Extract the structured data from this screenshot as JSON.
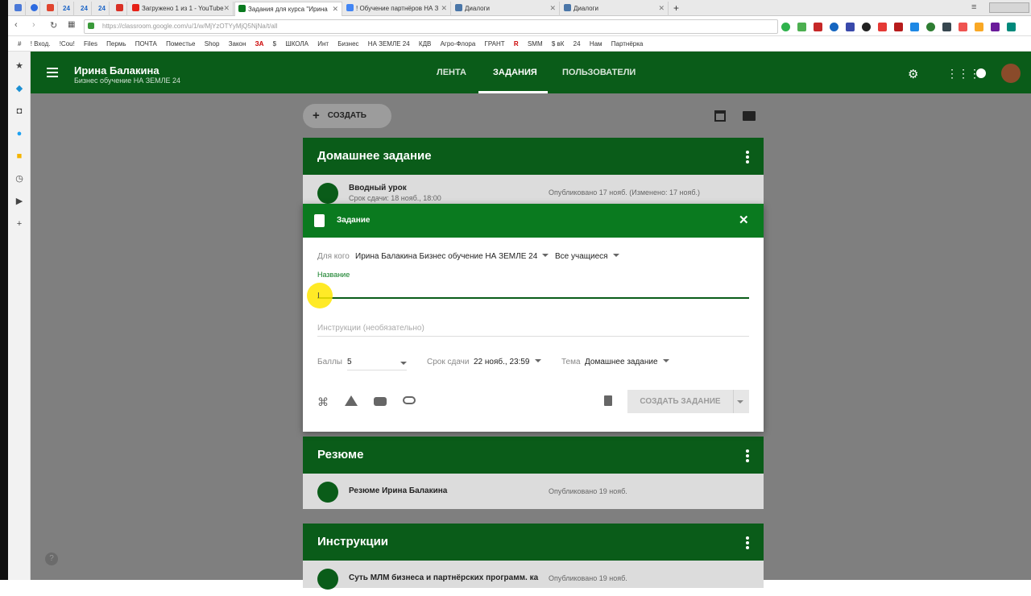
{
  "browser": {
    "tabs": [
      {
        "label": "24",
        "icon": "app-24"
      },
      {
        "label": "24",
        "icon": "app-24"
      },
      {
        "label": "24",
        "icon": "app-24"
      },
      {
        "label": "Загружено 1 из 1 - YouTube",
        "icon": "youtube-icon"
      },
      {
        "label": "Задания для курса \"Ирина",
        "icon": "classroom-icon",
        "active": true
      },
      {
        "label": "! Обучение партнёров НА З",
        "icon": "doc-icon"
      },
      {
        "label": "Диалоги",
        "icon": "chat-icon"
      },
      {
        "label": "Диалоги",
        "icon": "chat-icon"
      }
    ],
    "url": "https://classroom.google.com/u/1/w/MjYzOTYyMjQ5NjNa/t/all",
    "bookmarks": [
      "#",
      "! Вход.",
      "!Cou!",
      "Files",
      "Пермь",
      "ПОЧТА",
      "Поместье",
      "Shop",
      "Закон",
      "ЗА",
      "$",
      "ШКОЛА",
      "Инт",
      "Бизнес",
      "НА ЗЕМЛЕ 24",
      "КДВ",
      "Агро-Флора",
      "ГРАНТ",
      "R",
      "SMM",
      "$ вК",
      "24",
      "Нам",
      "Партнёрка"
    ]
  },
  "header": {
    "title": "Ирина Балакина",
    "subtitle": "Бизнес обучение НА ЗЕМЛЕ 24",
    "nav": [
      "ЛЕНТА",
      "ЗАДАНИЯ",
      "ПОЛЬЗОВАТЕЛИ"
    ],
    "active_nav": "ЗАДАНИЯ"
  },
  "toolbar": {
    "create_label": "СОЗДАТЬ"
  },
  "topics": [
    {
      "title": "Домашнее задание",
      "items": [
        {
          "title": "Вводный урок",
          "due": "Срок сдачи: 18 нояб., 18:00",
          "published": "Опубликовано 17 нояб. (Изменено: 17 нояб.)"
        }
      ]
    },
    {
      "title": "Резюме",
      "items": [
        {
          "title": "Резюме Ирина Балакина",
          "due": "",
          "published": "Опубликовано 19 нояб."
        }
      ]
    },
    {
      "title": "Инструкции",
      "items": [
        {
          "title": "Суть МЛМ бизнеса и партнёрских программ. ка",
          "due": "",
          "published": "Опубликовано 19 нояб."
        }
      ]
    }
  ],
  "dialog": {
    "title": "Задание",
    "for_label": "Для кого",
    "class_value": "Ирина Балакина Бизнес обучение НА ЗЕМЛЕ 24",
    "students_value": "Все учащиеся",
    "name_label": "Название",
    "name_value": "",
    "instructions_placeholder": "Инструкции (необязательно)",
    "points_label": "Баллы",
    "points_value": "5",
    "due_label": "Срок сдачи",
    "due_value": "22 нояб., 23:59",
    "topic_label": "Тема",
    "topic_value": "Домашнее задание",
    "create_button": "СОЗДАТЬ ЗАДАНИЕ"
  },
  "colors": {
    "brand_green": "#0a5c19",
    "dialog_header": "#0a7a1f",
    "overlay": "#7f7f7f"
  }
}
